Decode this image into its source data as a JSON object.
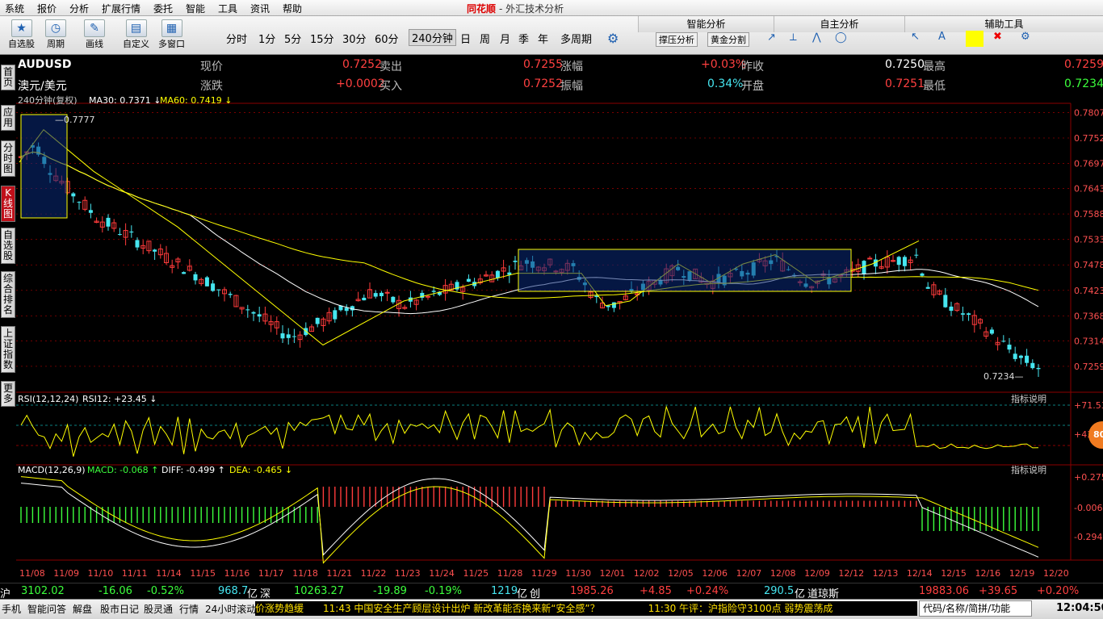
{
  "menu": [
    "系统",
    "报价",
    "分析",
    "扩展行情",
    "委托",
    "智能",
    "工具",
    "资讯",
    "帮助"
  ],
  "app_title": {
    "logo": "同花顺",
    "sub": "- 外汇技术分析"
  },
  "toolbar": {
    "buttons": [
      {
        "label": "自选股",
        "icon": "★"
      },
      {
        "label": "周期",
        "icon": "◷"
      },
      {
        "label": "画线",
        "icon": "✎"
      },
      {
        "label": "自定义",
        "icon": "▤"
      },
      {
        "label": "多窗口",
        "icon": "▦"
      }
    ],
    "periods": [
      "分时",
      "1分",
      "5分",
      "15分",
      "30分",
      "60分",
      "240分钟",
      "日",
      "周",
      "月",
      "季",
      "年",
      "多周期"
    ],
    "active_period": "240分钟"
  },
  "right_panel": {
    "smart": "智能分析",
    "self": "自主分析",
    "aux": "辅助工具",
    "btn1": "撑压分析",
    "btn2": "黄金分割",
    "draw_tools": [
      "↗",
      "⟂",
      "⋀",
      "◯"
    ],
    "aux_tools": [
      "↖",
      "A",
      "□",
      "✖",
      "⚙"
    ]
  },
  "sidetabs": [
    {
      "label": "首页"
    },
    {
      "label": "应用"
    },
    {
      "label": "分时图"
    },
    {
      "label": "K线图",
      "active": true
    },
    {
      "label": "自选股"
    },
    {
      "label": "综合排名"
    },
    {
      "label": "上证指数"
    },
    {
      "label": "更多"
    }
  ],
  "quote": {
    "code": "AUDUSD",
    "name": "澳元/美元",
    "now_label": "现价",
    "now": "0.7252",
    "sell_label": "卖出",
    "sell": "0.7255",
    "rise_label": "涨幅",
    "rise": "+0.03%",
    "prev_label": "昨收",
    "prev": "0.7250",
    "high_label": "最高",
    "high": "0.7259",
    "chg_label": "涨跌",
    "chg": "+0.0002",
    "buy_label": "买入",
    "buy": "0.7252",
    "amp_label": "振幅",
    "amp": "0.34%",
    "open_label": "开盘",
    "open": "0.7251",
    "low_label": "最低",
    "low": "0.7234"
  },
  "chart_data": {
    "type": "candlestick",
    "title": "240分钟(复权)",
    "ma30": "MA30: 0.7371",
    "ma60": "MA60: 0.7419",
    "price_ticks": [
      "0.7807",
      "0.7752",
      "0.7697",
      "0.7643",
      "0.7588",
      "0.7533",
      "0.7478",
      "0.7423",
      "0.7368",
      "0.7314",
      "0.7259"
    ],
    "ylim": [
      0.721,
      0.782
    ],
    "max_label": "0.7777",
    "min_label": "0.7234",
    "x_labels": [
      "11/08",
      "11/09",
      "11/10",
      "11/11",
      "11/14",
      "11/15",
      "11/16",
      "11/17",
      "11/18",
      "11/21",
      "11/22",
      "11/23",
      "11/24",
      "11/25",
      "11/28",
      "11/29",
      "11/30",
      "12/01",
      "12/02",
      "12/05",
      "12/06",
      "12/07",
      "12/08",
      "12/09",
      "12/12",
      "12/13",
      "12/14",
      "12/15",
      "12/16",
      "12/19",
      "12/20"
    ],
    "rsi": {
      "title": "RSI(12,12,24)",
      "value": "RSI12: +23.45",
      "ticks": [
        "+71.53",
        "+43.00"
      ]
    },
    "macd": {
      "title": "MACD(12,26,9)",
      "macd": "MACD: -0.068",
      "diff": "DIFF: -0.499",
      "dea": "DEA: -0.465",
      "ticks": [
        "+0.275",
        "-0.006",
        "-0.294"
      ]
    },
    "indicator_note": "指标说明",
    "colors": {
      "up": "#ff3b3b",
      "down": "#46e6f0",
      "ma30": "#ffffff",
      "ma60": "#ffff00",
      "grid": "#8b0000"
    }
  },
  "status": {
    "sh_label": "沪",
    "sh": "3102.02",
    "sh_chg": "-16.06",
    "sh_pct": "-0.52%",
    "sh_amt": "968.7",
    "yi": "亿",
    "sz_label": "深",
    "sz": "10263.27",
    "sz_chg": "-19.89",
    "sz_pct": "-0.19%",
    "sz_amt": "1219",
    "cy_label": "创",
    "cy": "1985.26",
    "cy_chg": "+4.85",
    "cy_pct": "+0.24%",
    "cy_amt": "290.5",
    "dj_label": "道琼斯",
    "dj": "19883.06",
    "dj_chg": "+39.65",
    "dj_pct": "+0.20%"
  },
  "bottom": {
    "items": [
      "手机",
      "智能问答",
      "解盘",
      "股市日记",
      "股灵通",
      "行情",
      "24小时滚动"
    ],
    "ticker": "价涨势趋缓　　11:43 中国安全生产顾层设计出炉 新改革能否换来新“安全感”？　　　　　11:30 午评：沪指险守3100点 弱势震荡成",
    "search": "代码/名称/简拼/功能",
    "time": "12:04:50"
  }
}
